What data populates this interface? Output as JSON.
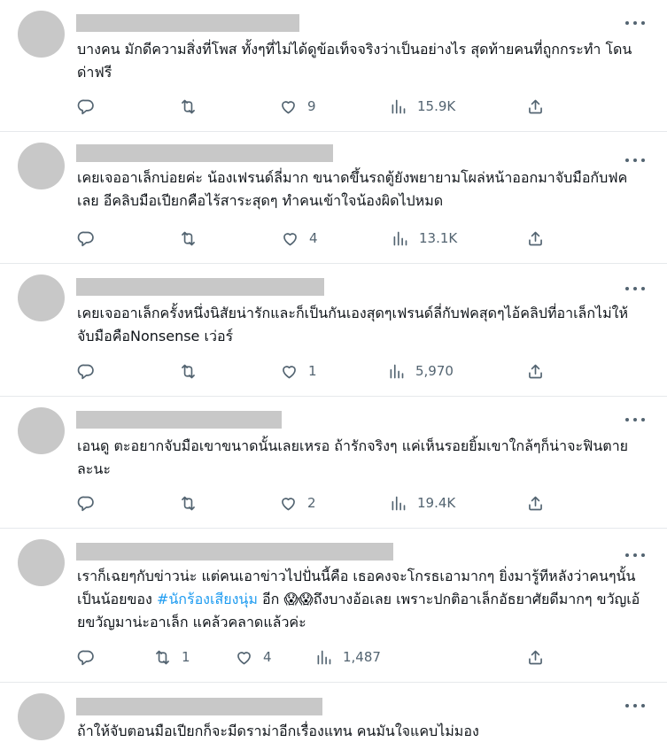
{
  "colors": {
    "text": "#0f1419",
    "secondary": "#536471",
    "link": "#1d9bf0",
    "placeholder": "#c8c8c8",
    "divider": "#e6e9ec"
  },
  "icons": {
    "reply": "reply-icon",
    "repost": "repost-icon",
    "like": "like-icon",
    "views": "views-icon",
    "share": "share-icon",
    "more": "more-icon"
  },
  "posts": [
    {
      "text_before": "บางคน มักดีความสิ่งที่โพส ทั้งๆที่ไม่ได้ดูข้อเท็จจริงว่าเป็นอย่างไร สุดท้ายคนที่ถูกกระทำ โดนด่าฟรี",
      "hashtag": "",
      "text_after": "",
      "replies": "",
      "reposts": "",
      "likes": "9",
      "views": "15.9K"
    },
    {
      "text_before": "เคยเจออาเล็กบ่อยค่ะ น้องเฟรนด์ลี่มาก ขนาดขึ้นรถตู้ยังพยายามโผล่หน้าออกมาจับมือกับฟคเลย อีคลิบมือเปียกคือไร้สาระสุดๆ ทำคนเข้าใจน้องผิดไปหมด",
      "hashtag": "",
      "text_after": "",
      "replies": "",
      "reposts": "",
      "likes": "4",
      "views": "13.1K"
    },
    {
      "text_before": "เคยเจออาเล็กครั้งหนึ่งนิสัยน่ารักและก็เป็นกันเองสุดๆเฟรนด์ลี่กับฟคสุดๆไอ้คลิปที่อาเล็กไม่ให้จับมือคือNonsense เว่อร์",
      "hashtag": "",
      "text_after": "",
      "replies": "",
      "reposts": "",
      "likes": "1",
      "views": "5,970"
    },
    {
      "text_before": "เอนดู ตะอยากจับมือเขาขนาดนั้นเลยเหรอ ถ้ารักจริงๆ แค่เห็นรอยยิ้มเขาใกล้ๆก็น่าจะฟินตายละนะ",
      "hashtag": "",
      "text_after": "",
      "replies": "",
      "reposts": "",
      "likes": "2",
      "views": "19.4K"
    },
    {
      "text_before": "เราก็เฉยๆกับข่าวน่ะ แต่คนเอาข่าวไปปั่นนี้คือ เธอคงจะโกรธเอามากๆ ยิ่งมารู้ทีหลังว่าคนๆนั้นเป็นน้อยของ ",
      "hashtag": "#นักร้องเสียงนุ่ม",
      "text_after": " อีก 😱😱ถึงบางอ้อเลย เพราะปกติอาเล็กอัธยาศัยดีมากๆ ขวัญเอ้ยขวัญมาน่ะอาเล็ก แคล้วคลาดแล้วค่ะ",
      "replies": "",
      "reposts": "1",
      "likes": "4",
      "views": "1,487"
    },
    {
      "text_before": "ถ้าให้จับตอนมือเปียกก็จะมีดราม่าอีกเรื่องแทน คนมันใจแคบไม่มอง",
      "hashtag": "",
      "text_after": "",
      "replies": "",
      "reposts": "",
      "likes": "",
      "views": ""
    }
  ]
}
